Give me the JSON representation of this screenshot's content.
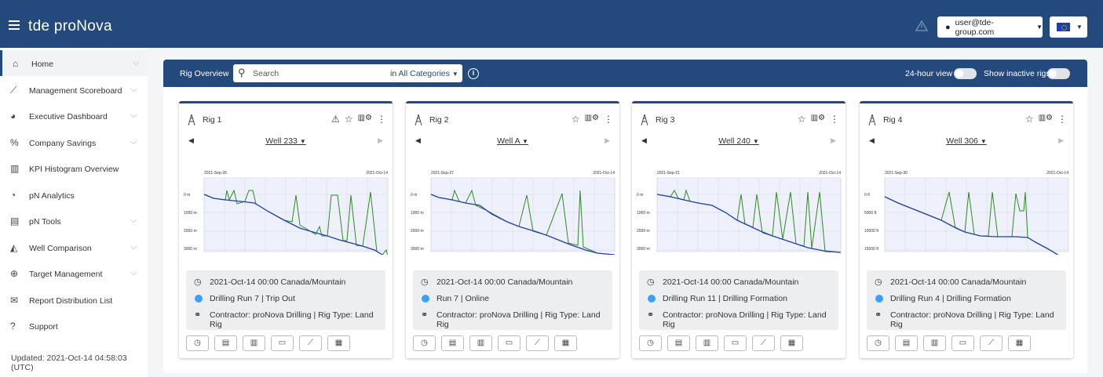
{
  "app": {
    "title": "tde proNova"
  },
  "header": {
    "user": "user@tde-group.com"
  },
  "sidebar": {
    "items": [
      {
        "label": "Home",
        "icon": "home-icon",
        "glyph": "⌂",
        "chevron": true
      },
      {
        "label": "Management Scoreboard",
        "icon": "line-chart-icon",
        "glyph": "⟋",
        "chevron": true
      },
      {
        "label": "Executive Dashboard",
        "icon": "dashboard-icon",
        "glyph": "◕",
        "chevron": true
      },
      {
        "label": "Company Savings",
        "icon": "percent-icon",
        "glyph": "%",
        "chevron": true
      },
      {
        "label": "KPI Histogram Overview",
        "icon": "bar-chart-icon",
        "glyph": "▥",
        "chevron": false
      },
      {
        "label": "pN Analytics",
        "icon": "pie-chart-icon",
        "glyph": "◔",
        "chevron": false
      },
      {
        "label": "pN Tools",
        "icon": "toolbox-icon",
        "glyph": "▤",
        "chevron": true
      },
      {
        "label": "Well Comparison",
        "icon": "area-chart-icon",
        "glyph": "◭",
        "chevron": true
      },
      {
        "label": "Target Management",
        "icon": "target-icon",
        "glyph": "⊕",
        "chevron": true
      },
      {
        "label": "Report Distribution List",
        "icon": "envelope-icon",
        "glyph": "✉",
        "chevron": false
      },
      {
        "label": "Support",
        "icon": "question-icon",
        "glyph": "?",
        "chevron": false
      }
    ],
    "updated": "Updated: 2021-Oct-14 04:58:03 (UTC)"
  },
  "panel": {
    "title": "Rig Overview",
    "search_placeholder": "Search",
    "search_in": "in",
    "category": "All Categories",
    "toggle_24h": "24-hour view",
    "toggle_inactive": "Show inactive rigs"
  },
  "cards": [
    {
      "rig": "Rig 1",
      "well": "Well 233",
      "warning": true,
      "date_start": "2021-Sep-26",
      "date_end": "2021-Oct-14",
      "yticks": [
        "0 m",
        "1000 m",
        "2000 m",
        "3000 m"
      ],
      "time": "2021-Oct-14 00:00 Canada/Mountain",
      "status": "Drilling Run 7 | Trip Out",
      "contractor": "Contractor: proNova Drilling | Rig Type: Land Rig"
    },
    {
      "rig": "Rig 2",
      "well": "Well A",
      "warning": false,
      "date_start": "2021-Sep-27",
      "date_end": "2021-Oct-14",
      "yticks": [
        "0 m",
        "1000 m",
        "2000 m",
        "3000 m"
      ],
      "time": "2021-Oct-14 00:00 Canada/Mountain",
      "status": "Run 7 | Online",
      "contractor": "Contractor: proNova Drilling | Rig Type: Land Rig"
    },
    {
      "rig": "Rig 3",
      "well": "Well 240",
      "warning": false,
      "date_start": "2021-Sep-21",
      "date_end": "2021-Oct-14",
      "yticks": [
        "0 m",
        "1000 m",
        "2000 m",
        "3000 m"
      ],
      "time": "2021-Oct-14 00:00 Canada/Mountain",
      "status": "Drilling Run 11 | Drilling Formation",
      "contractor": "Contractor: proNova Drilling | Rig Type: Land Rig"
    },
    {
      "rig": "Rig 4",
      "well": "Well 306",
      "warning": false,
      "date_start": "2021-Sep-30",
      "date_end": "2021-Oct-14",
      "yticks": [
        "0 ft",
        "5000 ft",
        "10000 ft",
        "15000 ft"
      ],
      "time": "2021-Oct-14 00:00 Canada/Mountain",
      "status": "Drilling Run 4 | Drilling Formation",
      "contractor": "Contractor: proNova Drilling | Rig Type: Land Rig"
    }
  ],
  "colors": {
    "primary": "#24497c",
    "depth_line": "#1f3fb0",
    "bit_line": "#2e8b20",
    "status_dot": "#3aa0ff"
  }
}
